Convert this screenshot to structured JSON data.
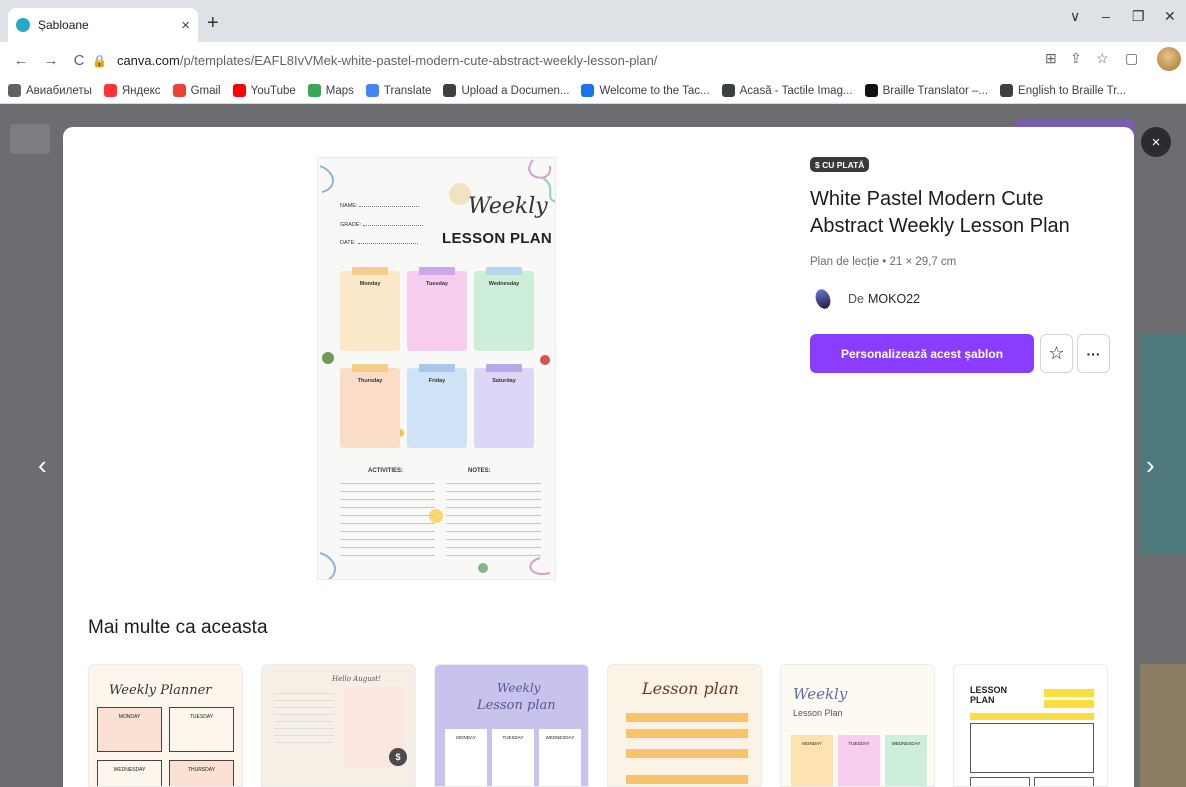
{
  "browser": {
    "tab_title": "Șabloane",
    "tab_close": "×",
    "new_tab": "+",
    "url_host": "canva.com",
    "url_path": "/p/templates/EAFL8IvVMek-white-pastel-modern-cute-abstract-weekly-lesson-plan/",
    "window_controls": [
      "∨",
      "–",
      "❐",
      "✕"
    ],
    "nav": {
      "back": "←",
      "forward": "→",
      "reload": "C"
    }
  },
  "bookmarks": [
    {
      "label": "Авиабилеты",
      "color": "#5f6368"
    },
    {
      "label": "Яндекс",
      "color": "#f33"
    },
    {
      "label": "Gmail",
      "color": "#ea4335"
    },
    {
      "label": "YouTube",
      "color": "#ff0000"
    },
    {
      "label": "Maps",
      "color": "#34a853"
    },
    {
      "label": "Translate",
      "color": "#4285f4"
    },
    {
      "label": "Upload a Documen...",
      "color": "#3c4043"
    },
    {
      "label": "Welcome to the Tac...",
      "color": "#1a73e8"
    },
    {
      "label": "Acasă - Tactile Imag...",
      "color": "#3c4043"
    },
    {
      "label": "Braille Translator –...",
      "color": "#111"
    },
    {
      "label": "English to Braille Tr...",
      "color": "#3c4043"
    }
  ],
  "modal": {
    "close": "×",
    "prev": "‹",
    "next": "›",
    "badge": "$ CU PLATĂ",
    "title": "White Pastel Modern Cute Abstract Weekly Lesson Plan",
    "meta": "Plan de lecție • 21 × 29,7 cm",
    "author_prefix": "De",
    "author": "MOKO22",
    "cta": "Personalizează acest șablon",
    "star": "☆",
    "more": "···"
  },
  "preview": {
    "weekly": "Weekly",
    "lesson_plan": "LESSON PLAN",
    "fields": [
      "NAME:",
      "GRADE:",
      "DATE:"
    ],
    "days": [
      "Monday",
      "Tuesday",
      "Wednesday",
      "Thursday",
      "Friday",
      "Saturday"
    ],
    "activities": "ACTIVITIES:",
    "notes": "NOTES:"
  },
  "more_section": {
    "heading": "Mai multe ca aceasta",
    "thumbnails": [
      {
        "title": "Weekly Planner",
        "sub1": "MONDAY",
        "sub2": "TUESDAY",
        "sub3": "WEDNESDAY",
        "sub4": "THURSDAY"
      },
      {
        "title": "Hello August!",
        "badge": "$"
      },
      {
        "title": "Weekly",
        "title2": "Lesson plan",
        "sub1": "MONDAY",
        "sub2": "TUESDAY",
        "sub3": "WEDNESDAY"
      },
      {
        "title": "Lesson plan"
      },
      {
        "title": "Weekly",
        "title2": "Lesson Plan",
        "sub1": "MONDAY",
        "sub2": "TUESDAY",
        "sub3": "WEDNESDAY"
      },
      {
        "title": "LESSON",
        "title2": "PLAN"
      }
    ]
  },
  "colors": {
    "accent": "#8b3dff",
    "overlay": "#6b6d71"
  }
}
